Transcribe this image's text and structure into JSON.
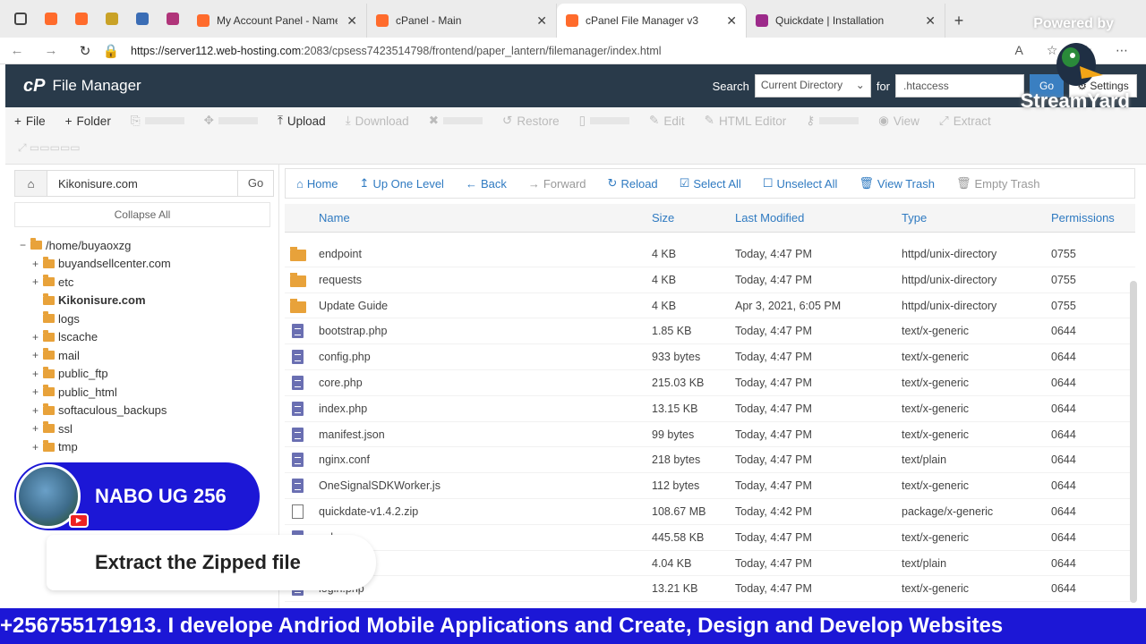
{
  "browser": {
    "tabs": [
      {
        "title": "My Account Panel - Namecheap",
        "color": "#ff6b2c"
      },
      {
        "title": "cPanel - Main",
        "color": "#ff6b2c"
      },
      {
        "title": "cPanel File Manager v3",
        "color": "#ff6b2c",
        "active": true
      },
      {
        "title": "Quickdate | Installation",
        "color": "#9c2a8a"
      }
    ],
    "url_host": "https://server112.web-hosting.com",
    "url_path": ":2083/cpsess7423514798/frontend/paper_lantern/filemanager/index.html",
    "powered_by": "Powered by"
  },
  "header": {
    "logo": "cP",
    "title": "File Manager",
    "search_label": "Search",
    "search_scope": "Current Directory",
    "for_label": "for",
    "search_value": ".htaccess",
    "go_label": "Go",
    "settings_label": "Settings"
  },
  "toolbar": {
    "items": [
      {
        "icon": "plus-icon",
        "glyph": "+",
        "label": "File",
        "enabled": true
      },
      {
        "icon": "plus-icon",
        "glyph": "+",
        "label": "Folder",
        "enabled": true
      },
      {
        "icon": "copy-icon",
        "glyph": "⎘",
        "label": "",
        "enabled": false
      },
      {
        "icon": "move-icon",
        "glyph": "✥",
        "label": "",
        "enabled": false
      },
      {
        "icon": "upload-icon",
        "glyph": "⤒",
        "label": "Upload",
        "enabled": true
      },
      {
        "icon": "download-icon",
        "glyph": "⤓",
        "label": "Download",
        "enabled": false
      },
      {
        "icon": "delete-icon",
        "glyph": "✖",
        "label": "",
        "enabled": false
      },
      {
        "icon": "restore-icon",
        "glyph": "↺",
        "label": "Restore",
        "enabled": false
      },
      {
        "icon": "rename-icon",
        "glyph": "▯",
        "label": "",
        "enabled": false
      },
      {
        "icon": "edit-icon",
        "glyph": "✎",
        "label": "Edit",
        "enabled": false
      },
      {
        "icon": "html-editor-icon",
        "glyph": "✎",
        "label": "HTML Editor",
        "enabled": false
      },
      {
        "icon": "permissions-icon",
        "glyph": "⚷",
        "label": "",
        "enabled": false
      },
      {
        "icon": "view-icon",
        "glyph": "◉",
        "label": "View",
        "enabled": false
      },
      {
        "icon": "extract-icon",
        "glyph": "⤢",
        "label": "Extract",
        "enabled": false
      }
    ]
  },
  "left": {
    "path_value": "Kikonisure.com",
    "go_label": "Go",
    "collapse_label": "Collapse All",
    "tree": [
      {
        "label": "/home/buyaoxzg",
        "toggle": "−",
        "indent": 0,
        "bold": false
      },
      {
        "label": "buyandsellcenter.com",
        "toggle": "+",
        "indent": 1,
        "bold": false
      },
      {
        "label": "etc",
        "toggle": "+",
        "indent": 1,
        "bold": false
      },
      {
        "label": "Kikonisure.com",
        "toggle": "",
        "indent": 1,
        "bold": true
      },
      {
        "label": "logs",
        "toggle": "",
        "indent": 1,
        "bold": false
      },
      {
        "label": "lscache",
        "toggle": "+",
        "indent": 1,
        "bold": false
      },
      {
        "label": "mail",
        "toggle": "+",
        "indent": 1,
        "bold": false
      },
      {
        "label": "public_ftp",
        "toggle": "+",
        "indent": 1,
        "bold": false
      },
      {
        "label": "public_html",
        "toggle": "+",
        "indent": 1,
        "bold": false
      },
      {
        "label": "softaculous_backups",
        "toggle": "+",
        "indent": 1,
        "bold": false
      },
      {
        "label": "ssl",
        "toggle": "+",
        "indent": 1,
        "bold": false
      },
      {
        "label": "tmp",
        "toggle": "+",
        "indent": 1,
        "bold": false
      }
    ]
  },
  "navbar": {
    "items": [
      {
        "icon": "home-icon",
        "glyph": "⌂",
        "label": "Home",
        "enabled": true
      },
      {
        "icon": "up-level-icon",
        "glyph": "↥",
        "label": "Up One Level",
        "enabled": true
      },
      {
        "icon": "back-icon",
        "glyph": "←",
        "label": "Back",
        "enabled": true
      },
      {
        "icon": "forward-icon",
        "glyph": "→",
        "label": "Forward",
        "enabled": false
      },
      {
        "icon": "reload-icon",
        "glyph": "↻",
        "label": "Reload",
        "enabled": true
      },
      {
        "icon": "select-all-icon",
        "glyph": "☑",
        "label": "Select All",
        "enabled": true
      },
      {
        "icon": "unselect-all-icon",
        "glyph": "☐",
        "label": "Unselect All",
        "enabled": true
      },
      {
        "icon": "trash-icon",
        "glyph": "🗑",
        "label": "View Trash",
        "enabled": true
      },
      {
        "icon": "empty-trash-icon",
        "glyph": "🗑",
        "label": "Empty Trash",
        "enabled": false
      }
    ]
  },
  "table": {
    "columns": [
      "Name",
      "Size",
      "Last Modified",
      "Type",
      "Permissions"
    ],
    "rows": [
      {
        "kind": "folder",
        "name": "endpoint",
        "size": "4 KB",
        "modified": "Today, 4:47 PM",
        "type": "httpd/unix-directory",
        "perm": "0755"
      },
      {
        "kind": "folder",
        "name": "requests",
        "size": "4 KB",
        "modified": "Today, 4:47 PM",
        "type": "httpd/unix-directory",
        "perm": "0755"
      },
      {
        "kind": "folder",
        "name": "Update Guide",
        "size": "4 KB",
        "modified": "Apr 3, 2021, 6:05 PM",
        "type": "httpd/unix-directory",
        "perm": "0755"
      },
      {
        "kind": "file",
        "name": "bootstrap.php",
        "size": "1.85 KB",
        "modified": "Today, 4:47 PM",
        "type": "text/x-generic",
        "perm": "0644"
      },
      {
        "kind": "file",
        "name": "config.php",
        "size": "933 bytes",
        "modified": "Today, 4:47 PM",
        "type": "text/x-generic",
        "perm": "0644"
      },
      {
        "kind": "file",
        "name": "core.php",
        "size": "215.03 KB",
        "modified": "Today, 4:47 PM",
        "type": "text/x-generic",
        "perm": "0644"
      },
      {
        "kind": "file",
        "name": "index.php",
        "size": "13.15 KB",
        "modified": "Today, 4:47 PM",
        "type": "text/x-generic",
        "perm": "0644"
      },
      {
        "kind": "file",
        "name": "manifest.json",
        "size": "99 bytes",
        "modified": "Today, 4:47 PM",
        "type": "text/x-generic",
        "perm": "0644"
      },
      {
        "kind": "file",
        "name": "nginx.conf",
        "size": "218 bytes",
        "modified": "Today, 4:47 PM",
        "type": "text/plain",
        "perm": "0644"
      },
      {
        "kind": "file",
        "name": "OneSignalSDKWorker.js",
        "size": "112 bytes",
        "modified": "Today, 4:47 PM",
        "type": "text/x-generic",
        "perm": "0644"
      },
      {
        "kind": "zip",
        "name": "quickdate-v1.4.2.zip",
        "size": "108.67 MB",
        "modified": "Today, 4:42 PM",
        "type": "package/x-generic",
        "perm": "0644"
      },
      {
        "kind": "file",
        "name": "sql",
        "size": "445.58 KB",
        "modified": "Today, 4:47 PM",
        "type": "text/x-generic",
        "perm": "0644"
      },
      {
        "kind": "file",
        "name": "",
        "size": "4.04 KB",
        "modified": "Today, 4:47 PM",
        "type": "text/plain",
        "perm": "0644"
      },
      {
        "kind": "file",
        "name": "login.php",
        "size": "13.21 KB",
        "modified": "Today, 4:47 PM",
        "type": "text/x-generic",
        "perm": "0644"
      }
    ]
  },
  "overlay": {
    "streamyard": "StreamYard",
    "presenter": "NABO UG 256",
    "banner": "Extract the Zipped file",
    "ticker": "+256755171913. I develope Andriod Mobile Applications and Create, Design and Develop Websites",
    "brand_color": "#1c17d6"
  }
}
